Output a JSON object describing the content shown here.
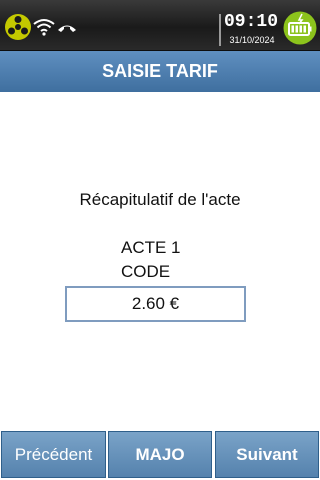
{
  "status": {
    "time": "09:10",
    "date": "31/10/2024"
  },
  "header": {
    "title": "SAISIE TARIF"
  },
  "main": {
    "summary_title": "Récapitulatif de l'acte",
    "act_label": "ACTE 1",
    "code_label": "CODE",
    "amount": "2.60 €"
  },
  "footer": {
    "previous_label": "Précédent",
    "majo_label": "MAJO",
    "next_label": "Suivant"
  },
  "colors": {
    "title_bar": "#4f7fb0",
    "softkey": "#6792bc",
    "battery": "#8cc31c"
  }
}
